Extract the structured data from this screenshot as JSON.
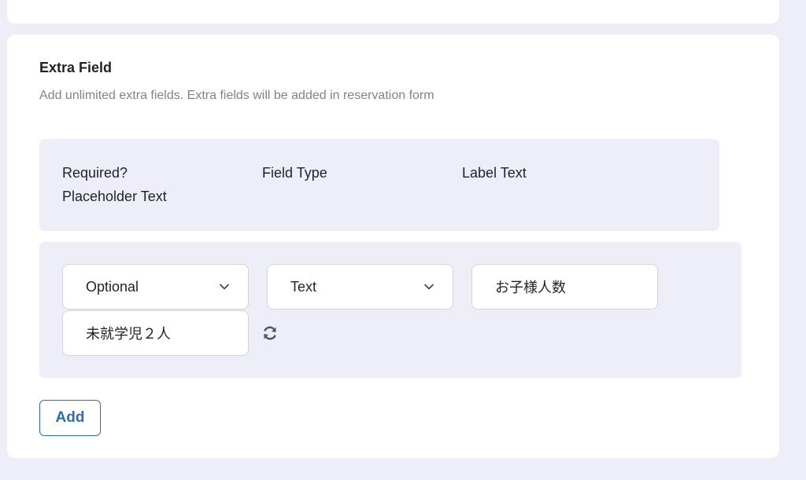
{
  "section": {
    "title": "Extra Field",
    "description": "Add unlimited extra fields. Extra fields will be added in reservation form"
  },
  "columns": {
    "required": "Required?",
    "field_type": "Field Type",
    "label_text": "Label Text",
    "placeholder_text": "Placeholder Text"
  },
  "row": {
    "required_value": "Optional",
    "field_type_value": "Text",
    "label_value": "お子様人数",
    "placeholder_value": "未就学児２人"
  },
  "buttons": {
    "add_label": "Add"
  },
  "icons": {
    "dropdown": "chevron-down-icon",
    "refresh": "refresh-icon"
  }
}
